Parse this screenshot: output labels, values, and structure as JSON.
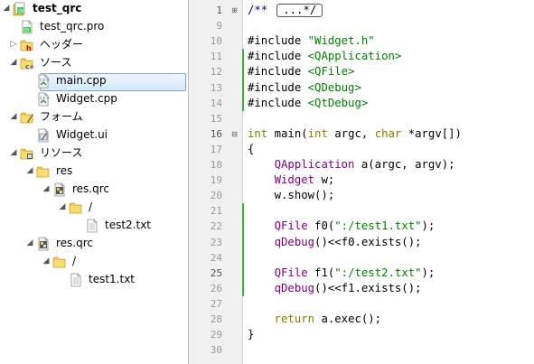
{
  "tree": {
    "items": [
      {
        "label": "test_qrc",
        "bold": true,
        "icon": "qt-project-icon",
        "arrow": "expanded"
      },
      {
        "label": "test_qrc.pro",
        "icon": "pro-file-icon",
        "arrow": ""
      },
      {
        "label": "ヘッダー",
        "icon": "header-folder-icon",
        "arrow": "collapsed"
      },
      {
        "label": "ソース",
        "icon": "source-folder-icon",
        "arrow": "expanded"
      },
      {
        "label": "main.cpp",
        "icon": "cpp-file-icon",
        "arrow": "",
        "selected": true
      },
      {
        "label": "Widget.cpp",
        "icon": "cpp-file-icon",
        "arrow": ""
      },
      {
        "label": "フォーム",
        "icon": "forms-folder-icon",
        "arrow": "expanded"
      },
      {
        "label": "Widget.ui",
        "icon": "ui-file-icon",
        "arrow": ""
      },
      {
        "label": "リソース",
        "icon": "resources-folder-icon",
        "arrow": "expanded"
      },
      {
        "label": "res",
        "icon": "folder-icon",
        "arrow": "expanded"
      },
      {
        "label": "res.qrc",
        "icon": "qrc-file-icon",
        "arrow": "expanded"
      },
      {
        "label": "/",
        "icon": "folder-icon",
        "arrow": "expanded"
      },
      {
        "label": "test2.txt",
        "icon": "text-file-icon",
        "arrow": ""
      },
      {
        "label": "res.qrc",
        "icon": "qrc-file-icon",
        "arrow": "expanded"
      },
      {
        "label": "/",
        "icon": "folder-icon",
        "arrow": "expanded"
      },
      {
        "label": "test1.txt",
        "icon": "text-file-icon",
        "arrow": ""
      }
    ]
  },
  "editor": {
    "line_numbers": [
      "1",
      "9",
      "10",
      "11",
      "12",
      "13",
      "14",
      "15",
      "16",
      "17",
      "18",
      "19",
      "20",
      "21",
      "22",
      "23",
      "24",
      "25",
      "26",
      "27",
      "28",
      "29",
      "30"
    ],
    "collapsed_comment": {
      "prefix": "/**",
      "box": "...*/"
    },
    "lines": [
      "",
      "",
      "#include \"Widget.h\"",
      "#include <QApplication>",
      "#include <QFile>",
      "#include <QDebug>",
      "#include <QtDebug>",
      "",
      "int main(int argc, char *argv[])",
      "{",
      "    QApplication a(argc, argv);",
      "    Widget w;",
      "    w.show();",
      "",
      "    QFile f0(\":/test1.txt\");",
      "    qDebug()<<f0.exists();",
      "",
      "    QFile f1(\":/test2.txt\");",
      "    qDebug()<<f1.exists();",
      "",
      "    return a.exec();",
      "}",
      ""
    ]
  },
  "colors": {
    "keyword": "#808000",
    "string": "#008000",
    "class": "#800080",
    "change_marker": "#3eb43e"
  }
}
